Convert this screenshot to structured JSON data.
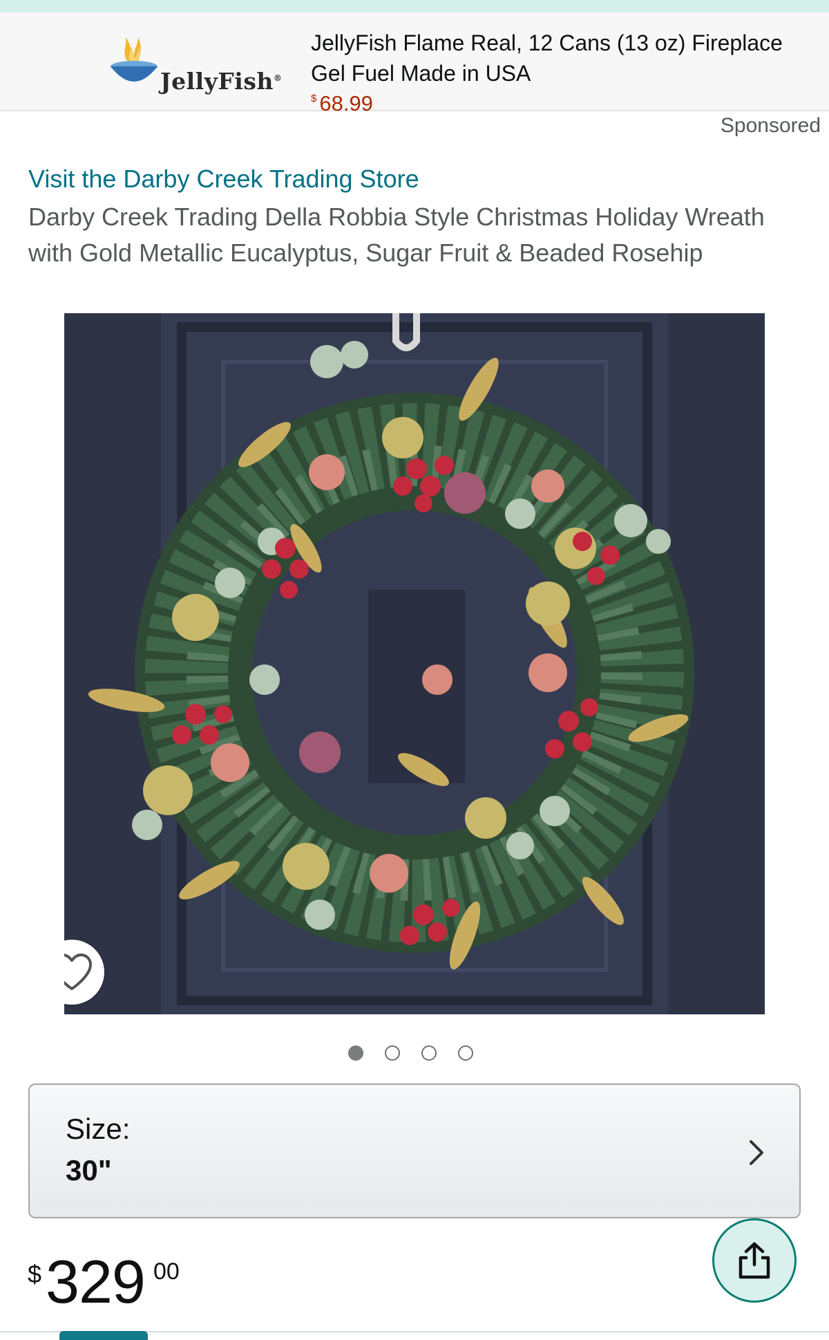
{
  "ad_banner": {
    "brand_name": "JellyFish",
    "brand_mark": "®",
    "title": "JellyFish Flame Real, 12 Cans (13 oz) Fireplace Gel Fuel Made in USA",
    "price_currency": "$",
    "price_value": "68.99",
    "sponsored_label": "Sponsored"
  },
  "product": {
    "store_link": "Visit the Darby Creek Trading Store",
    "title": "Darby Creek Trading Della Robbia Style Christmas Holiday Wreath with Gold Metallic Eucalyptus, Sugar Fruit & Beaded Rosehip",
    "image_count": 4,
    "active_image_index": 0
  },
  "size": {
    "label": "Size:",
    "value": "30\""
  },
  "price": {
    "currency": "$",
    "whole": "329",
    "fraction": "00"
  },
  "icons": {
    "heart": "heart-outline-icon",
    "chevron": "chevron-right-icon",
    "share": "share-icon"
  },
  "colors": {
    "link": "#007185",
    "ad_price": "#b12704",
    "accent": "#0a7e74"
  }
}
